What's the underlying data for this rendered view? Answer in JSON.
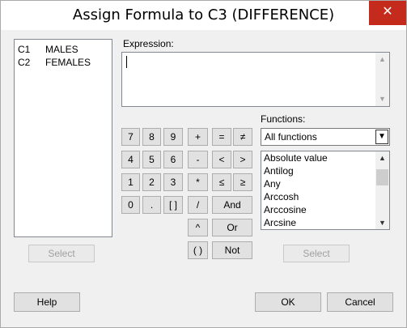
{
  "window": {
    "title": "Assign Formula to C3 (DIFFERENCE)",
    "close_glyph": "✕"
  },
  "columns": [
    {
      "id": "C1",
      "name": "MALES"
    },
    {
      "id": "C2",
      "name": "FEMALES"
    }
  ],
  "left_select_label": "Select",
  "expression": {
    "label": "Expression:",
    "value": ""
  },
  "keypad": {
    "digits_row1": [
      "7",
      "8",
      "9"
    ],
    "digits_row2": [
      "4",
      "5",
      "6"
    ],
    "digits_row3": [
      "1",
      "2",
      "3"
    ],
    "digits_row4": [
      "0",
      ".",
      "[ ]"
    ],
    "ops": [
      "+",
      "-",
      "*",
      "/",
      "^",
      "( )"
    ],
    "compare": [
      "=",
      "≠",
      "<",
      ">",
      "≤",
      "≥"
    ],
    "logic": [
      "And",
      "Or",
      "Not"
    ]
  },
  "functions": {
    "label": "Functions:",
    "filter": "All functions",
    "items": [
      "Absolute value",
      "Antilog",
      "Any",
      "Arccosh",
      "Arccosine",
      "Arcsine"
    ]
  },
  "right_select_label": "Select",
  "footer": {
    "help": "Help",
    "ok": "OK",
    "cancel": "Cancel"
  }
}
